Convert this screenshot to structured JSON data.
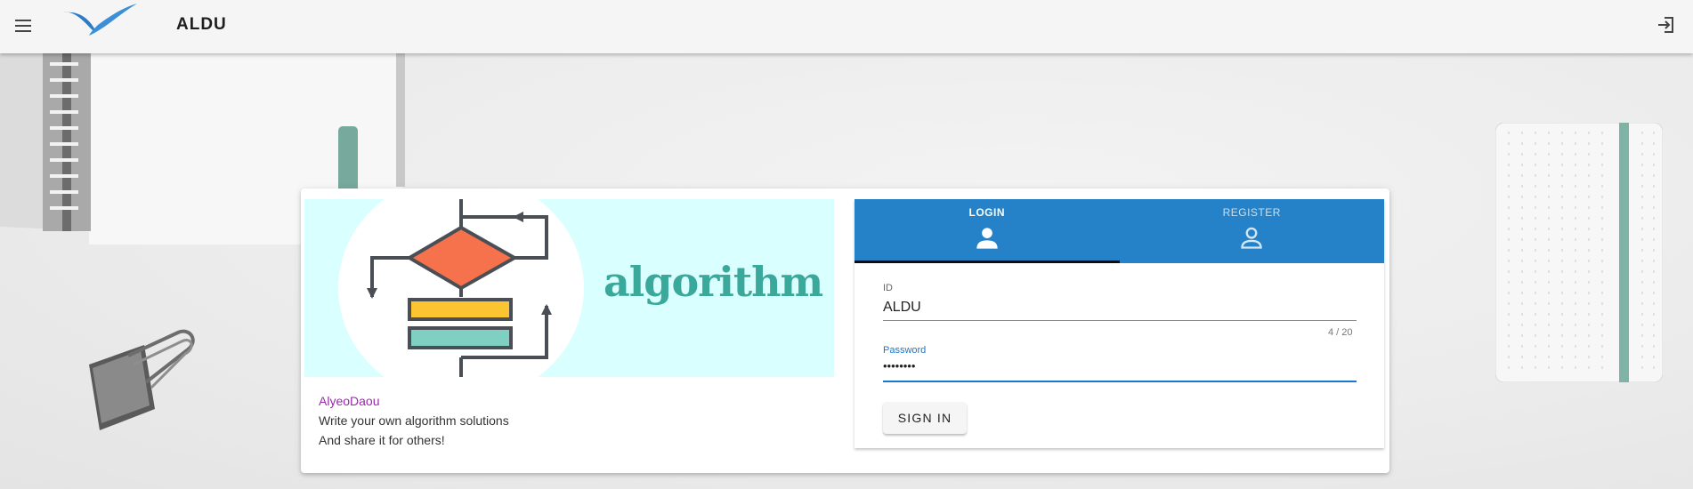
{
  "header": {
    "title": "ALDU",
    "menu_icon": "menu-icon",
    "login_icon": "login-icon"
  },
  "banner": {
    "text": "algorithm",
    "colors": {
      "background": "#d9ffff",
      "diamond": "#f5724c",
      "bar_yellow": "#fbc531",
      "bar_teal": "#7fcfc3",
      "text": "#3aa89a"
    }
  },
  "info": {
    "brand": "AlyeoDaou",
    "line1": "Write your own algorithm solutions",
    "line2": "And share it for others!"
  },
  "login": {
    "tabs": [
      {
        "label": "LOGIN",
        "icon": "user-filled-icon",
        "active": true
      },
      {
        "label": "REGISTER",
        "icon": "user-outline-icon",
        "active": false
      }
    ],
    "id_label": "ID",
    "id_value": "ALDU",
    "id_counter": "4 / 20",
    "password_label": "Password",
    "password_value": "••••••••",
    "signin_label": "SIGN IN"
  },
  "colors": {
    "tab_bar": "#2582c8",
    "focus": "#1976d2",
    "brand": "#9c27b0"
  }
}
